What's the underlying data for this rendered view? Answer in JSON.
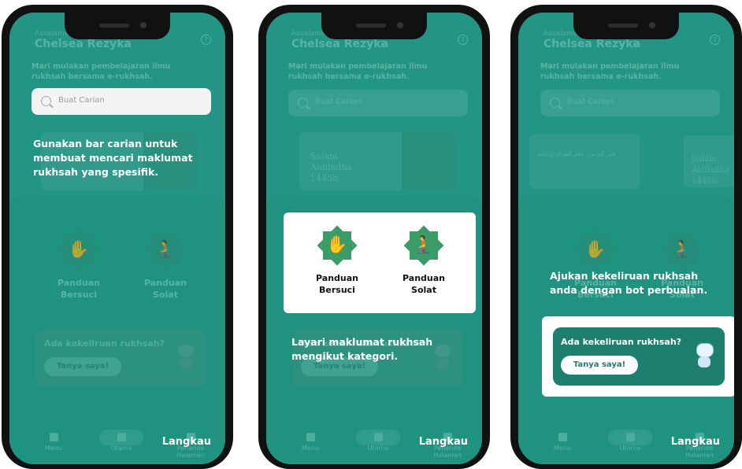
{
  "common": {
    "greeting": "Assalamualaikum",
    "user_name": "Chelsea Rezyka",
    "subtitle": "Mari mulakan pembelajaran ilmu rukhsah bersama e-rukhsah.",
    "search_placeholder": "Buat Carian",
    "banner1_title": "Salam Aidiladha 1445h",
    "banner2_text": "خير كم من تعلم القرآن وعلمه",
    "categories": [
      {
        "label": "Panduan Bersuci",
        "icon": "hand-washing-icon"
      },
      {
        "label": "Panduan Solat",
        "icon": "prayer-icon"
      }
    ],
    "card_question": "Ada kekeliruan rukhsah?",
    "card_button": "Tanya saya!",
    "nav": [
      "Menu",
      "Utama",
      "Penanda Halaman"
    ],
    "skip_label": "Langkau"
  },
  "screens": [
    {
      "tip": "Gunakan bar carian untuk membuat mencari maklumat rukhsah yang spesifik."
    },
    {
      "tip": "Layari maklumat rukhsah mengikut kategori."
    },
    {
      "tip": "Ajukan kekeliruan rukhsah anda dengan bot perbualan."
    }
  ],
  "colors": {
    "accent": "#2aa592",
    "highlight_card": "#1d7f6e",
    "overlay": "#147869"
  }
}
